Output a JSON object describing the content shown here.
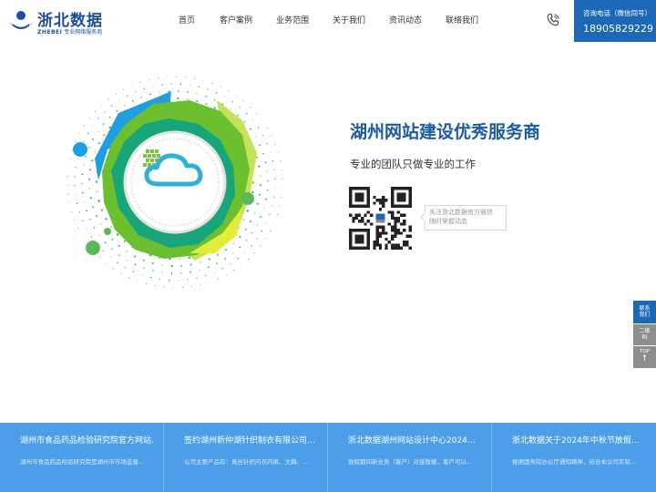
{
  "header": {
    "logo": {
      "cn": "浙北数据",
      "en_brand": "ZHEBEI",
      "en_tagline": "专业网络服务商"
    },
    "nav": [
      {
        "label": "首页"
      },
      {
        "label": "客户案例"
      },
      {
        "label": "业务范围"
      },
      {
        "label": "关于我们"
      },
      {
        "label": "资讯动态"
      },
      {
        "label": "联络我们"
      }
    ],
    "hotline": {
      "label": "咨询电话（微信同号）",
      "number": "18905829229"
    }
  },
  "hero": {
    "title": "湖州网站建设优秀服务商",
    "subtitle": "专业的团队只做专业的工作",
    "qr_caption_line1": "关注浙北数据官方微信",
    "qr_caption_line2": "随时掌握动态"
  },
  "float": {
    "contact_line1": "联系",
    "contact_line2": "我们",
    "qr_line1": "二维",
    "qr_line2": "码",
    "top_label": "TOP",
    "top_arrow": "↑"
  },
  "news": [
    {
      "title": "湖州市食品药品检验研究院官方网站…",
      "desc": "湖州市食品药品检验研究院是湖州市市场监督…"
    },
    {
      "title": "签约湖州新仲湖针织制衣有限公司…",
      "desc": "公司主要产品有：真丝针织内衣内裤、文胸、…"
    },
    {
      "title": "浙北数据湖州网站设计中心2024…",
      "desc": "放假期间新业务（客户）对接暂缓，客户可以…"
    },
    {
      "title": "浙北数据关于2024年中秋节放假…",
      "desc": "根据国务院办公厅通知精神，结合本公司实际…"
    }
  ],
  "colors": {
    "brand_blue": "#1d68b6",
    "title_blue": "#1d5aa3",
    "news_bar": "#4c9ee9",
    "float_gray": "#8d8d8d",
    "graphic_green": "#6cbf2f",
    "graphic_teal": "#19a57a",
    "graphic_cyan": "#1ea0e0"
  },
  "icons": {
    "logo": "logo-mark-icon",
    "phone": "phone-icon",
    "qr": "qr-code-icon",
    "cloud": "cloud-icon"
  }
}
